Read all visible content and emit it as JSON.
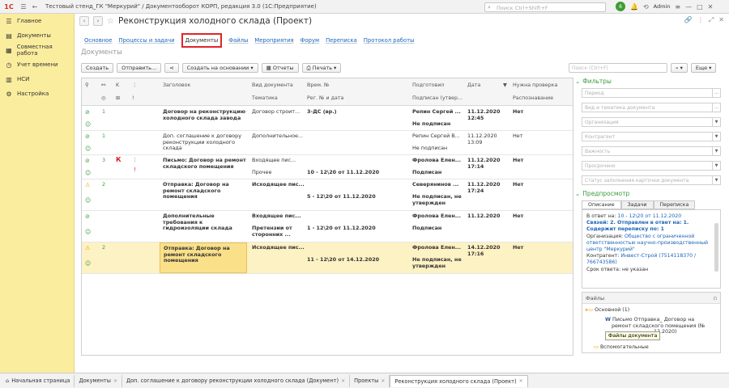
{
  "app": {
    "title": "Тестовый стенд_ГК \"Меркурий\" / Документооборот КОРП, редакция 3.0  (1С:Предприятие)",
    "logo": "1С",
    "search_placeholder": "Поиск Ctrl+Shift+F",
    "user": "Admin",
    "notifications": "6"
  },
  "sidebar": {
    "items": [
      {
        "label": "Главное",
        "icon": "menu-icon"
      },
      {
        "label": "Документы",
        "icon": "documents-icon"
      },
      {
        "label": "Совместная работа",
        "icon": "collaboration-icon"
      },
      {
        "label": "Учет времени",
        "icon": "clock-icon"
      },
      {
        "label": "НСИ",
        "icon": "book-icon"
      },
      {
        "label": "Настройка",
        "icon": "gear-icon"
      }
    ]
  },
  "header": {
    "title": "Реконструкция холодного склада (Проект)"
  },
  "tabs": [
    "Основное",
    "Процессы и задачи",
    "Документы",
    "Файлы",
    "Мероприятия",
    "Форум",
    "Переписка",
    "Протокол работы"
  ],
  "section_title": "Документы",
  "toolbar": {
    "create": "Создать",
    "send": "Отправить...",
    "create_based": "Создать на основании",
    "reports": "Отчеты",
    "print": "Печать",
    "search_placeholder": "Поиск (Ctrl+F)",
    "more": "Еще"
  },
  "table": {
    "headers": {
      "title": "Заголовок",
      "doc_type": "Вид документа",
      "temporal": "Врем. №",
      "prepared": "Подготовил",
      "date": "Дата",
      "need_check": "Нужна проверка",
      "topic": "Тематика",
      "reg": "Рег. № и дата",
      "signed": "Подписан (утвер...",
      "recognition": "Распознавание"
    },
    "rows": [
      {
        "num": "1",
        "k": "",
        "title": "Договор на реконструкцию холодного склада завода",
        "doc_type": "Договор строит...",
        "topic": "",
        "temporal": "3-ДС (вр.)",
        "reg": "",
        "prepared": "Репин Сергей ...",
        "signed": "Не подписан",
        "date": "11.12.2020",
        "time": "12:45",
        "check": "Нет"
      },
      {
        "num": "1",
        "k": "",
        "title": "Доп. соглашение к договору реконструкции холодного склада",
        "doc_type": "Дополнительное...",
        "topic": "",
        "temporal": "",
        "reg": "",
        "prepared": "Репин Сергей В...",
        "signed": "Не подписан",
        "date": "11.12.2020",
        "time": "13:09",
        "check": "Нет"
      },
      {
        "num": "3",
        "k": "К",
        "title": "Письмо: Договор на ремонт складского помещения",
        "doc_type": "Входящее пис...",
        "topic": "Прочее",
        "temporal": "",
        "reg": "10 - 12\\20 от 11.12.2020",
        "prepared": "Фролова Елен...",
        "signed": "Подписан",
        "date": "11.12.2020",
        "time": "17:14",
        "check": "Нет"
      },
      {
        "num": "2",
        "k": "",
        "title": "Отправка: Договор на ремонт складского помещения",
        "doc_type": "Исходящее пис...",
        "topic": "",
        "temporal": "",
        "reg": "5 - 12\\20 от 11.12.2020",
        "prepared": "Северянинов ...",
        "signed": "Не подписан, не утвержден",
        "date": "11.12.2020",
        "time": "17:24",
        "check": "Нет"
      },
      {
        "num": "",
        "k": "",
        "title": "Дополнительные требования к гидроизоляции склада",
        "doc_type": "Входящее пис...",
        "topic": "Претензии от сторонних ...",
        "temporal": "",
        "reg": "1 - 12\\20 от 11.12.2020",
        "prepared": "Фролова Елен...",
        "signed": "Подписан",
        "date": "11.12.2020",
        "time": "",
        "check": "Нет"
      },
      {
        "num": "2",
        "k": "",
        "title": "Отправка: Договор на ремонт складского помещения",
        "doc_type": "Исходящее пис...",
        "topic": "",
        "temporal": "",
        "reg": "11 - 12\\20 от 14.12.2020",
        "prepared": "Фролова Елен...",
        "signed": "Не подписан, не утвержден",
        "date": "14.12.2020",
        "time": "17:16",
        "check": "Нет"
      }
    ]
  },
  "filters": {
    "title": "Фильтры",
    "fields": [
      "Период",
      "Вид и тематика документа",
      "Организация",
      "Контрагент",
      "Важность",
      "Просрочено",
      "Статус заполнения карточки документа"
    ]
  },
  "preview": {
    "title": "Предпросмотр",
    "tabs": [
      "Описание",
      "Задачи",
      "Переписка"
    ],
    "in_reply_label": "В ответ на:",
    "in_reply_value": "10 - 12\\20 от 11.12.2020",
    "links_text": "Связей: 2. Отправлен в ответ на: 1. Содержит переписку по: 1",
    "org_label": "Организация:",
    "org_value": "Общество с ограниченной ответственностью научно-производственный центр \"Меркурий\"",
    "contractor_label": "Контрагент:",
    "contractor_value": "Инвест-Строй (7514118370 / 766743586)",
    "deadline_label": "Срок ответа:",
    "deadline_value": "не указан"
  },
  "files": {
    "title": "Файлы",
    "main_folder": "Основной (1)",
    "file_line1": "Письмо Отправка_ Договор на",
    "file_line2": "ремонт складского помещения (№",
    "file_line3": "12.2020)",
    "tooltip": "Файлы документа",
    "aux_folder": "Вспомогательные"
  },
  "bottom_tabs": [
    "Начальная страница",
    "Документы",
    "Доп. соглашение к договору реконструкции холодного склада (Документ)",
    "Проекты",
    "Реконструкция холодного склада (Проект)"
  ]
}
